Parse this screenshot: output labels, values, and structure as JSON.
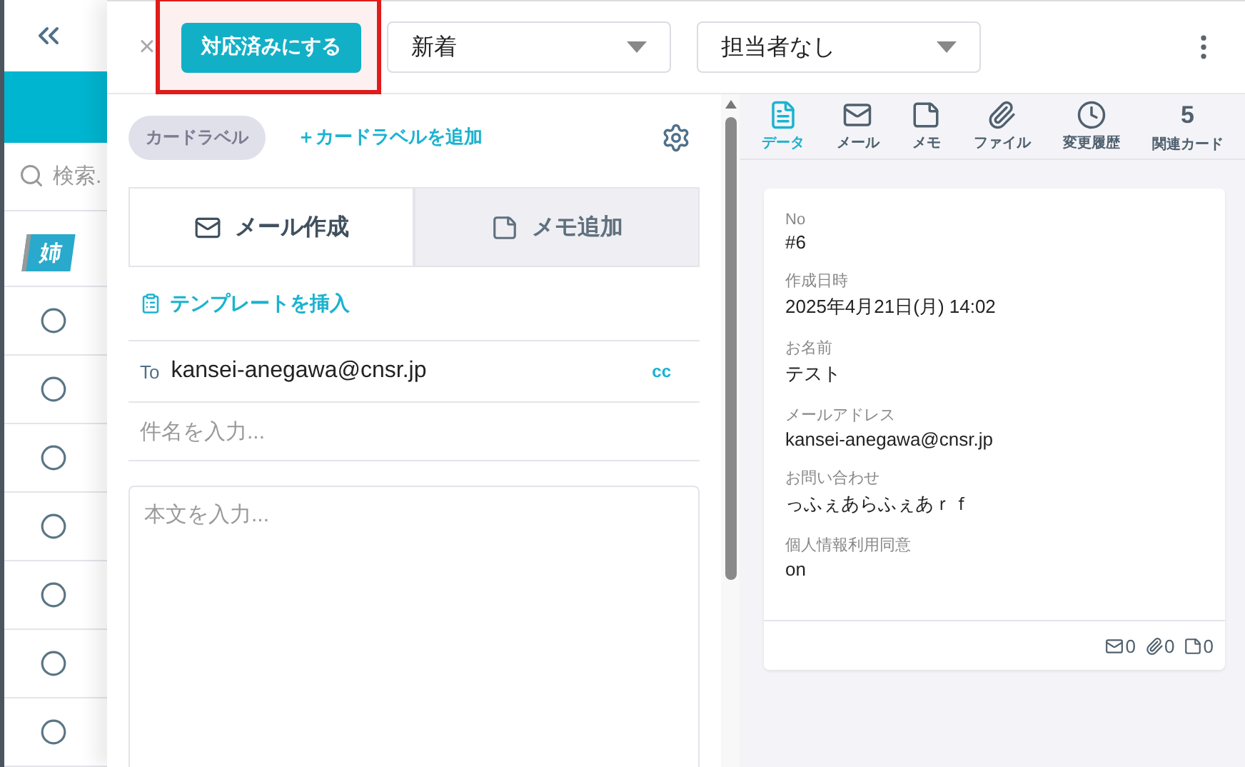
{
  "sidebar": {
    "search": {
      "placeholder": "検索."
    },
    "badge": "姉",
    "rows": [
      {
        "checked": false
      },
      {
        "checked": false
      },
      {
        "checked": false
      },
      {
        "checked": false
      },
      {
        "checked": false
      },
      {
        "checked": false
      },
      {
        "checked": false
      }
    ]
  },
  "topbar": {
    "close": "×",
    "done_button": {
      "label": "対応済みにする",
      "highlighted": true
    },
    "status_select": {
      "value": "新着"
    },
    "assignee_select": {
      "value": "担当者なし"
    }
  },
  "labels": {
    "chip": "カードラベル",
    "add_link": "＋カードラベルを追加"
  },
  "compose_tabs": [
    {
      "label": "メール作成",
      "kind": "mail",
      "selected": true
    },
    {
      "label": "メモ追加",
      "kind": "memo",
      "selected": false
    }
  ],
  "template_link": "テンプレートを挿入",
  "to": {
    "label": "To",
    "value": "kansei-anegawa@cnsr.jp",
    "cc": "cc"
  },
  "subject": {
    "placeholder": "件名を入力..."
  },
  "body": {
    "placeholder": "本文を入力..."
  },
  "detail_tabs": [
    {
      "label": "データ",
      "kind": "data",
      "selected": true
    },
    {
      "label": "メール",
      "kind": "mail",
      "selected": false
    },
    {
      "label": "メモ",
      "kind": "memo",
      "selected": false
    },
    {
      "label": "ファイル",
      "kind": "file",
      "selected": false
    },
    {
      "label": "変更履歴",
      "kind": "history",
      "selected": false
    },
    {
      "label": "関連カード",
      "kind": "count",
      "count": "5",
      "selected": false
    }
  ],
  "fields": [
    {
      "label": "No",
      "value": "#6"
    },
    {
      "label": "作成日時",
      "value": "2025年4月21日(月) 14:02"
    },
    {
      "label": "お名前",
      "value": "テスト"
    },
    {
      "label": "メールアドレス",
      "value": "kansei-anegawa@cnsr.jp"
    },
    {
      "label": "お問い合わせ",
      "value": "っふぇあらふぇあｒｆ"
    },
    {
      "label": "個人情報利用同意",
      "value": "on"
    }
  ],
  "counts": [
    {
      "kind": "mail",
      "value": "0"
    },
    {
      "kind": "file",
      "value": "0"
    },
    {
      "kind": "memo",
      "value": "0"
    }
  ]
}
